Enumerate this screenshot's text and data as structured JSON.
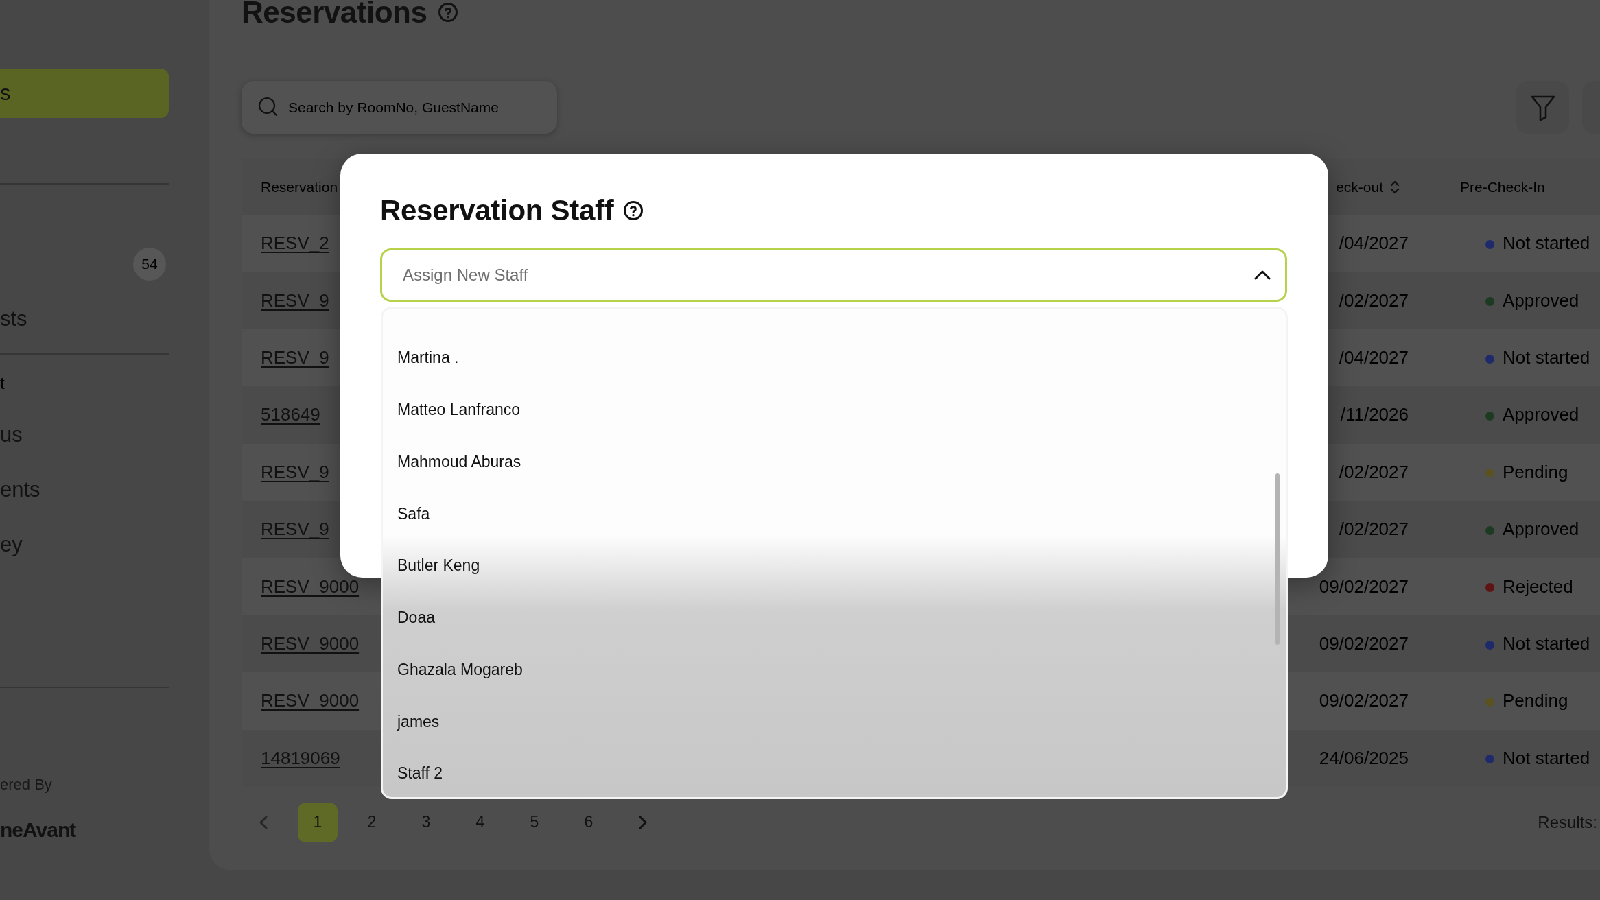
{
  "sidebar": {
    "items": [
      {
        "kind": "item",
        "label": "s",
        "selected": true
      },
      {
        "kind": "divider"
      },
      {
        "kind": "badge",
        "badge": "54"
      },
      {
        "kind": "item",
        "label": "sts",
        "selected": false
      },
      {
        "kind": "divider"
      },
      {
        "kind": "section",
        "label": "t"
      },
      {
        "kind": "item",
        "label": "us",
        "selected": false
      },
      {
        "kind": "item",
        "label": "ents",
        "selected": false
      },
      {
        "kind": "item",
        "label": "ey",
        "selected": false
      },
      {
        "kind": "divider"
      }
    ],
    "powered_by": "ered By",
    "brand": "neAvant"
  },
  "page": {
    "title": "Reservations",
    "search": {
      "placeholder": "Search by RoomNo, GuestName"
    }
  },
  "table": {
    "columns": [
      {
        "label": "Reservation"
      },
      {
        "label": "eck-out",
        "sortable": true
      },
      {
        "label": "Pre-Check-In"
      }
    ],
    "rows": [
      {
        "reservation": "RESV_2",
        "check_out": "/04/2027",
        "status": "Not started",
        "color": "#1f2a6b"
      },
      {
        "reservation": "RESV_9",
        "check_out": "/02/2027",
        "status": "Approved",
        "color": "#1d3a22"
      },
      {
        "reservation": "RESV_9",
        "check_out": "/04/2027",
        "status": "Not started",
        "color": "#1f2a6b"
      },
      {
        "reservation": "518649",
        "check_out": "/11/2026",
        "status": "Approved",
        "color": "#1d3a22"
      },
      {
        "reservation": "RESV_9",
        "check_out": "/02/2027",
        "status": "Pending",
        "color": "#5a5220"
      },
      {
        "reservation": "RESV_9",
        "check_out": "/02/2027",
        "status": "Approved",
        "color": "#1d3a22"
      },
      {
        "reservation": "RESV_9000",
        "check_out": "09/02/2027",
        "status": "Rejected",
        "color": "#5e1414"
      },
      {
        "reservation": "RESV_9000",
        "check_out": "09/02/2027",
        "status": "Not started",
        "color": "#1f2a6b"
      },
      {
        "reservation": "RESV_9000",
        "check_out": "09/02/2027",
        "status": "Pending",
        "color": "#5a5220"
      },
      {
        "reservation": "14819069",
        "check_out": "24/06/2025",
        "status": "Not started",
        "color": "#1f2a6b"
      }
    ]
  },
  "pagination": {
    "pages": [
      {
        "label": "1",
        "selected": true
      },
      {
        "label": "2",
        "selected": false
      },
      {
        "label": "3",
        "selected": false
      },
      {
        "label": "4",
        "selected": false
      },
      {
        "label": "5",
        "selected": false
      },
      {
        "label": "6",
        "selected": false
      }
    ],
    "results": "Results:"
  },
  "modal": {
    "title": "Reservation Staff",
    "select": {
      "placeholder": "Assign New Staff",
      "expanded": true
    },
    "options": [
      "Martina .",
      "Matteo Lanfranco",
      "Mahmoud Aburas",
      "Safa",
      "Butler Keng",
      "Doaa",
      "Ghazala Mogareb",
      "james",
      "Staff 2"
    ]
  }
}
